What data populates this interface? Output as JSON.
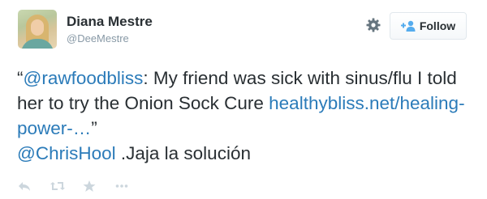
{
  "user": {
    "name": "Diana Mestre",
    "handle": "@DeeMestre"
  },
  "header": {
    "follow_label": "Follow"
  },
  "tweet": {
    "open_quote": "“",
    "mention1": "@rawfoodbliss",
    "text1": ": My friend was sick with sinus/flu I told her to try the Onion Sock Cure ",
    "link": "healthybliss.net/healing-power-…",
    "close_quote": "”",
    "mention2": "@ChrisHool",
    "text2": " .Jaja la solución"
  },
  "actions": {
    "icons": [
      "reply-icon",
      "retweet-icon",
      "favorite-icon",
      "more-icon"
    ]
  },
  "colors": {
    "link": "#2b7bb9",
    "text": "#292f33",
    "muted": "#8899a6",
    "action_icon": "#ccd6dd"
  }
}
